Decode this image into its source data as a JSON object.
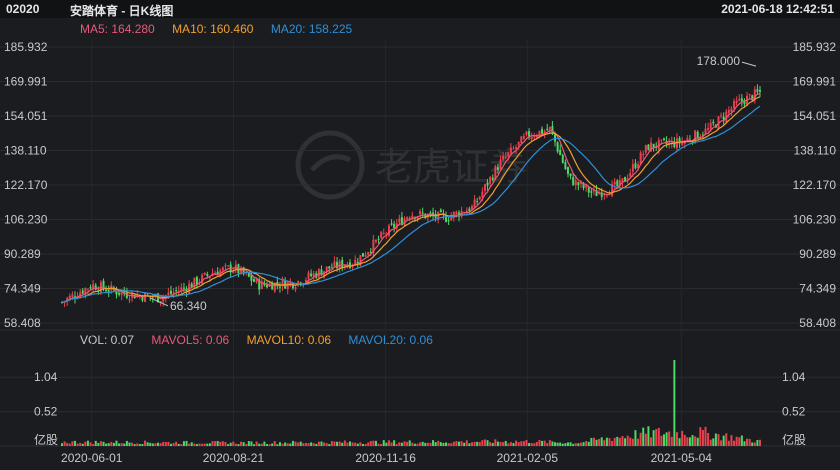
{
  "header": {
    "code": "02020",
    "title": "安踏体育 - 日K线图",
    "datetime": "2021-06-18 12:42:51"
  },
  "ma_legend": {
    "ma5": "MA5: 164.280",
    "ma10": "MA10: 160.460",
    "ma20": "MA20: 158.225"
  },
  "vol_legend": {
    "vol": "VOL: 0.07",
    "mavol5": "MAVOL5: 0.06",
    "mavol10": "MAVOL10: 0.06",
    "mavol20": "MAVOL20: 0.06"
  },
  "watermark": "老虎证券",
  "colors": {
    "up": "#e8414d",
    "down": "#4cd964",
    "ma5": "#e8597a",
    "ma10": "#f0a030",
    "ma20": "#2f8fd6",
    "background": "#1b1c20"
  },
  "chart_data": [
    {
      "type": "candlestick",
      "title": "安踏体育 - 日K线图",
      "y_ticks": [
        "185.932",
        "169.991",
        "154.051",
        "138.110",
        "122.170",
        "106.230",
        "90.289",
        "74.349",
        "58.408"
      ],
      "ylim": [
        58.408,
        185.932
      ],
      "x_ticks": [
        "2020-06-01",
        "2020-08-21",
        "2020-11-16",
        "2021-02-05",
        "2021-05-04"
      ],
      "annotations": {
        "max": "178.000",
        "min": "66.340"
      },
      "close_path": [
        {
          "date": "2020-05-15",
          "close": 68
        },
        {
          "date": "2020-06-01",
          "close": 76
        },
        {
          "date": "2020-06-20",
          "close": 72
        },
        {
          "date": "2020-07-10",
          "close": 70
        },
        {
          "date": "2020-07-25",
          "close": 75
        },
        {
          "date": "2020-08-10",
          "close": 82
        },
        {
          "date": "2020-08-21",
          "close": 84
        },
        {
          "date": "2020-09-05",
          "close": 76
        },
        {
          "date": "2020-09-25",
          "close": 77
        },
        {
          "date": "2020-10-15",
          "close": 84
        },
        {
          "date": "2020-10-30",
          "close": 87
        },
        {
          "date": "2020-11-16",
          "close": 100
        },
        {
          "date": "2020-11-30",
          "close": 109
        },
        {
          "date": "2020-12-20",
          "close": 107
        },
        {
          "date": "2021-01-05",
          "close": 112
        },
        {
          "date": "2021-01-20",
          "close": 132
        },
        {
          "date": "2021-02-05",
          "close": 145
        },
        {
          "date": "2021-02-18",
          "close": 148
        },
        {
          "date": "2021-03-01",
          "close": 125
        },
        {
          "date": "2021-03-15",
          "close": 118
        },
        {
          "date": "2021-03-30",
          "close": 122
        },
        {
          "date": "2021-04-15",
          "close": 140
        },
        {
          "date": "2021-05-04",
          "close": 142
        },
        {
          "date": "2021-05-20",
          "close": 148
        },
        {
          "date": "2021-06-05",
          "close": 160
        },
        {
          "date": "2021-06-18",
          "close": 165
        }
      ],
      "ma": [
        {
          "name": "MA5",
          "value": 164.28
        },
        {
          "name": "MA10",
          "value": 160.46
        },
        {
          "name": "MA20",
          "value": 158.225
        }
      ]
    },
    {
      "type": "bar",
      "title": "VOL",
      "y_ticks": [
        "1.04",
        "0.52",
        "亿股"
      ],
      "ylim": [
        0,
        1.3
      ],
      "volume_path": [
        {
          "date": "2020-05-15",
          "volume": 0.06
        },
        {
          "date": "2020-08-21",
          "volume": 0.05
        },
        {
          "date": "2020-11-16",
          "volume": 0.06
        },
        {
          "date": "2021-02-05",
          "volume": 0.07
        },
        {
          "date": "2021-03-05",
          "volume": 0.05
        },
        {
          "date": "2021-04-15",
          "volume": 0.2
        },
        {
          "date": "2021-04-30",
          "volume": 1.3
        },
        {
          "date": "2021-05-04",
          "volume": 0.25
        },
        {
          "date": "2021-06-18",
          "volume": 0.07
        }
      ],
      "mavol": [
        {
          "name": "MAVOL5",
          "value": 0.06
        },
        {
          "name": "MAVOL10",
          "value": 0.06
        },
        {
          "name": "MAVOL20",
          "value": 0.06
        }
      ]
    }
  ]
}
